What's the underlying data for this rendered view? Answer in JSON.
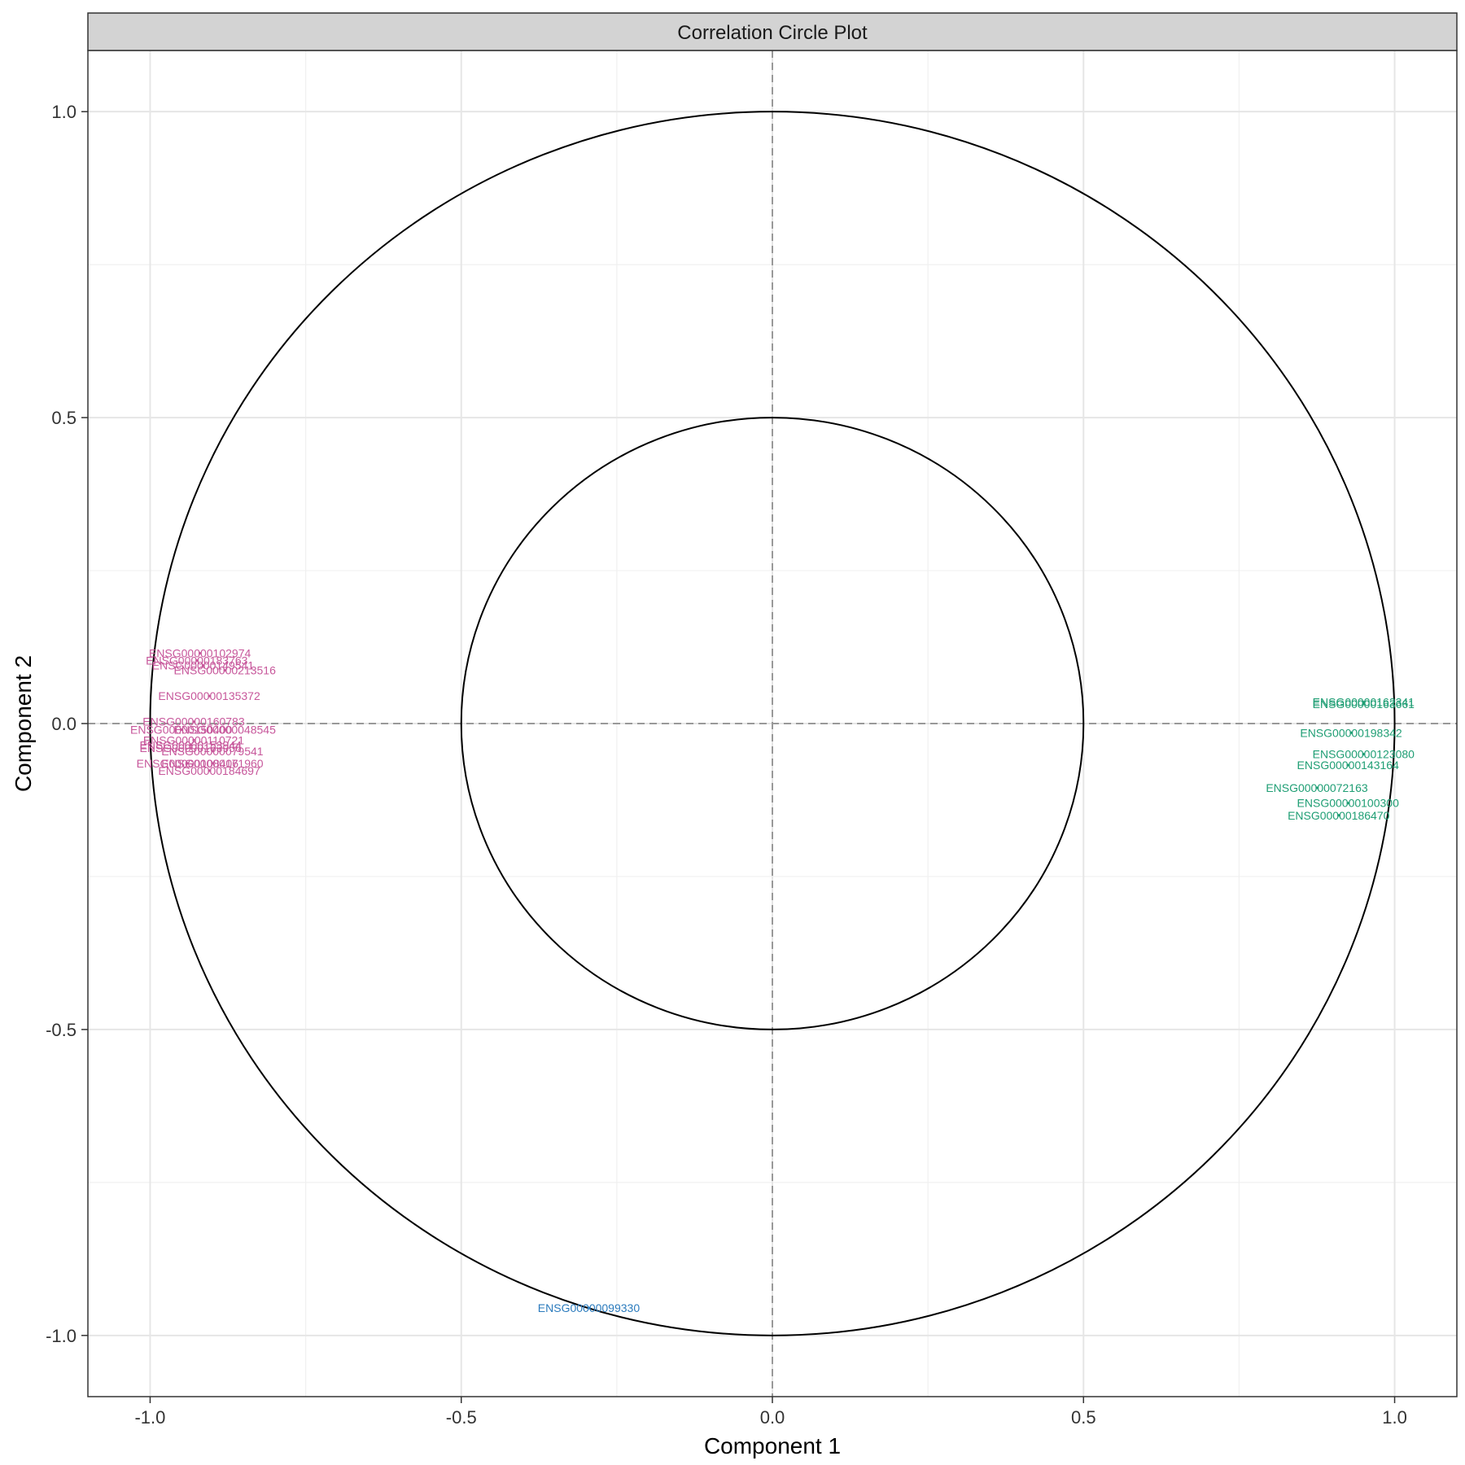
{
  "chart_data": {
    "type": "scatter",
    "title": "Correlation Circle Plot",
    "xlabel": "Component  1",
    "ylabel": "Component  2",
    "xlim": [
      -1.1,
      1.1
    ],
    "ylim": [
      -1.1,
      1.1
    ],
    "xticks": [
      -1.0,
      -0.5,
      0.0,
      0.5,
      1.0
    ],
    "xtick_labels": [
      "-1.0",
      "-0.5",
      "0.0",
      "0.5",
      "1.0"
    ],
    "yticks": [
      -1.0,
      -0.5,
      0.0,
      0.5,
      1.0
    ],
    "ytick_labels": [
      "-1.0",
      "-0.5",
      "0.0",
      "0.5",
      "1.0"
    ],
    "grid": true,
    "legend": "none",
    "circles": [
      {
        "radius": 1.0,
        "color": "#000000"
      },
      {
        "radius": 0.5,
        "color": "#000000"
      }
    ],
    "reference_lines": {
      "x": 0,
      "y": 0,
      "style": "dashed",
      "color": "#999999"
    },
    "series": [
      {
        "color": "#c7579b",
        "points": [
          {
            "label": "ENSG00000102974",
            "x": -0.92,
            "y": 0.115
          },
          {
            "label": "ENSG00000183763",
            "x": -0.925,
            "y": 0.103
          },
          {
            "label": "ENSG00000149541",
            "x": -0.915,
            "y": 0.095
          },
          {
            "label": "ENSG00000213516",
            "x": -0.88,
            "y": 0.087
          },
          {
            "label": "ENSG00000135372",
            "x": -0.905,
            "y": 0.045
          },
          {
            "label": "ENSG00000160783",
            "x": -0.93,
            "y": 0.003
          },
          {
            "label": "ENSG00000150400",
            "x": -0.95,
            "y": -0.01
          },
          {
            "label": "ENSG00000048545",
            "x": -0.88,
            "y": -0.01
          },
          {
            "label": "ENSG00000110721",
            "x": -0.93,
            "y": -0.027
          },
          {
            "label": "ENSG00000153944",
            "x": -0.935,
            "y": -0.035
          },
          {
            "label": "ENSG00000163956",
            "x": -0.935,
            "y": -0.04
          },
          {
            "label": "ENSG00000079541",
            "x": -0.9,
            "y": -0.045
          },
          {
            "label": "ENSG00000108406",
            "x": -0.94,
            "y": -0.065
          },
          {
            "label": "ENSG00000171960",
            "x": -0.9,
            "y": -0.065
          },
          {
            "label": "ENSG00000184697",
            "x": -0.905,
            "y": -0.077
          }
        ]
      },
      {
        "color": "#1f9e74",
        "points": [
          {
            "label": "ENSG00000162341",
            "x": 0.95,
            "y": 0.035
          },
          {
            "label": "ENSG00000163661",
            "x": 0.95,
            "y": 0.032
          },
          {
            "label": "ENSG00000198342",
            "x": 0.93,
            "y": -0.015
          },
          {
            "label": "ENSG00000123080",
            "x": 0.95,
            "y": -0.05
          },
          {
            "label": "ENSG00000143164",
            "x": 0.925,
            "y": -0.068
          },
          {
            "label": "ENSG00000072163",
            "x": 0.875,
            "y": -0.105
          },
          {
            "label": "ENSG00000100300",
            "x": 0.925,
            "y": -0.13
          },
          {
            "label": "ENSG00000186470",
            "x": 0.91,
            "y": -0.15
          }
        ]
      },
      {
        "color": "#2b7bbd",
        "points": [
          {
            "label": "ENSG00000099330",
            "x": -0.295,
            "y": -0.955
          }
        ]
      }
    ]
  }
}
